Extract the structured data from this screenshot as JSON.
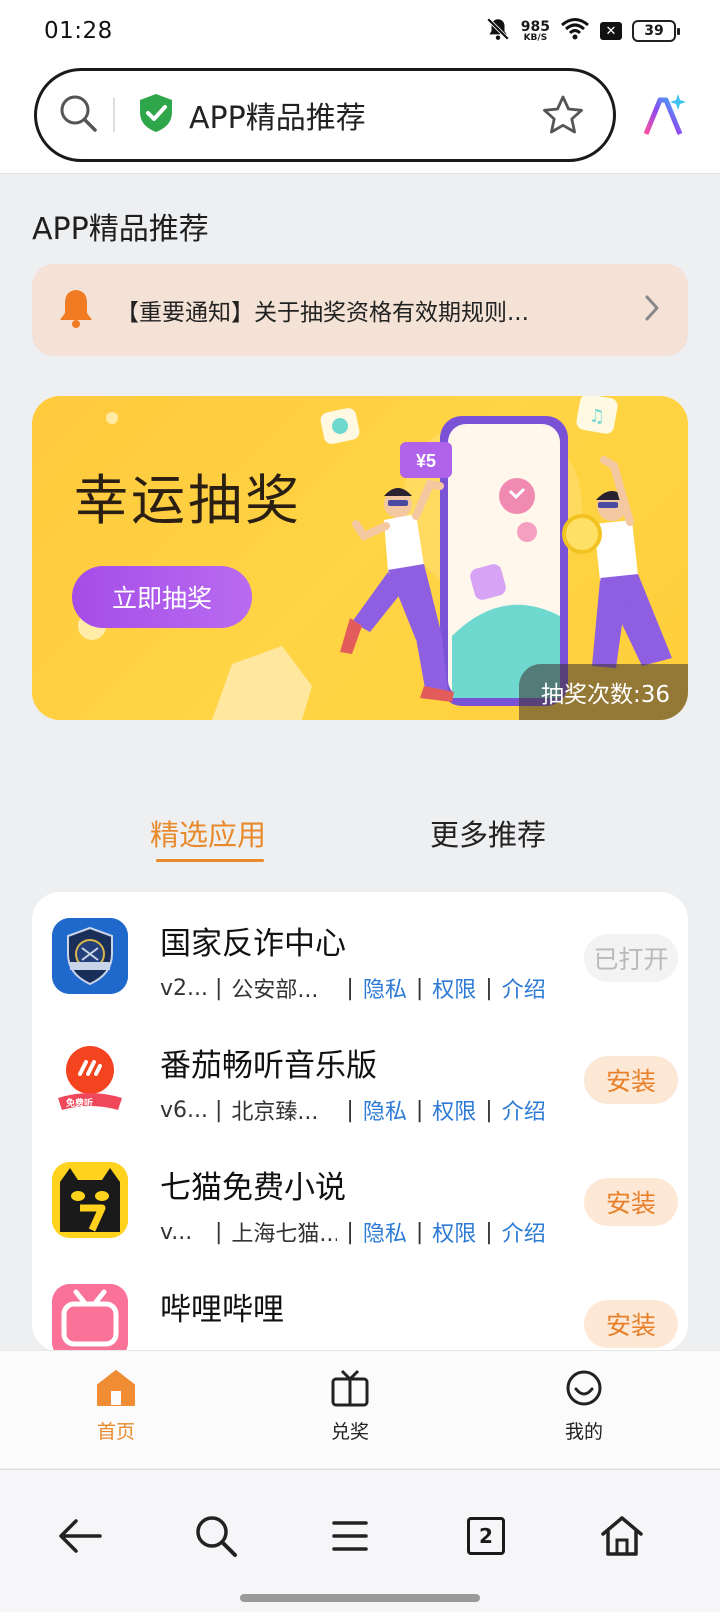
{
  "status_bar": {
    "time": "01:28",
    "net_speed_value": "985",
    "net_speed_unit": "KB/S",
    "battery": "39",
    "icons": [
      "mute-icon",
      "wifi-icon",
      "sim-x-icon",
      "battery-icon"
    ]
  },
  "address_bar": {
    "title": "APP精品推荐",
    "icons": [
      "search-icon",
      "shield-check-icon",
      "star-icon",
      "ai-assistant-icon"
    ]
  },
  "page": {
    "heading": "APP精品推荐"
  },
  "notice": {
    "text": "【重要通知】关于抽奖资格有效期规则...",
    "icons": [
      "bell-icon",
      "chevron-right-icon"
    ]
  },
  "banner": {
    "title": "幸运抽奖",
    "button_label": "立即抽奖",
    "draw_count": "抽奖次数:36",
    "price_tag": "¥5"
  },
  "tabs": [
    {
      "label": "精选应用",
      "active": true
    },
    {
      "label": "更多推荐",
      "active": false
    }
  ],
  "apps": [
    {
      "name": "国家反诈中心",
      "version": "v2...",
      "developer": "公安部...",
      "privacy": "隐私",
      "permission": "权限",
      "intro": "介绍",
      "action": "已打开",
      "action_state": "opened",
      "icon": "anti-fraud-app-icon"
    },
    {
      "name": "番茄畅听音乐版",
      "version": "v6...",
      "developer": "北京臻...",
      "privacy": "隐私",
      "permission": "权限",
      "intro": "介绍",
      "action": "安装",
      "action_state": "install",
      "icon": "tomato-music-app-icon",
      "icon_badge": "免费听"
    },
    {
      "name": "七猫免费小说",
      "version": "v...",
      "developer": "上海七猫...",
      "privacy": "隐私",
      "permission": "权限",
      "intro": "介绍",
      "action": "安装",
      "action_state": "install",
      "icon": "qimao-novel-app-icon"
    },
    {
      "name": "哔哩哔哩",
      "action": "安装",
      "action_state": "install",
      "icon": "bilibili-app-icon"
    }
  ],
  "page_nav": [
    {
      "label": "首页",
      "icon": "home-filled-icon",
      "active": true
    },
    {
      "label": "兑奖",
      "icon": "tv-gift-icon",
      "active": false
    },
    {
      "label": "我的",
      "icon": "smile-icon",
      "active": false
    }
  ],
  "browser_toolbar": {
    "tab_count": "2",
    "icons": [
      "back-arrow-icon",
      "search-icon",
      "menu-icon",
      "tabs-icon",
      "home-icon"
    ]
  },
  "colors": {
    "accent": "#e88a2c",
    "link": "#2d7bd6",
    "banner_yellow": "#ffcf3a",
    "button_purple": "#a44de8",
    "notice_bg": "#f3e2d5"
  }
}
